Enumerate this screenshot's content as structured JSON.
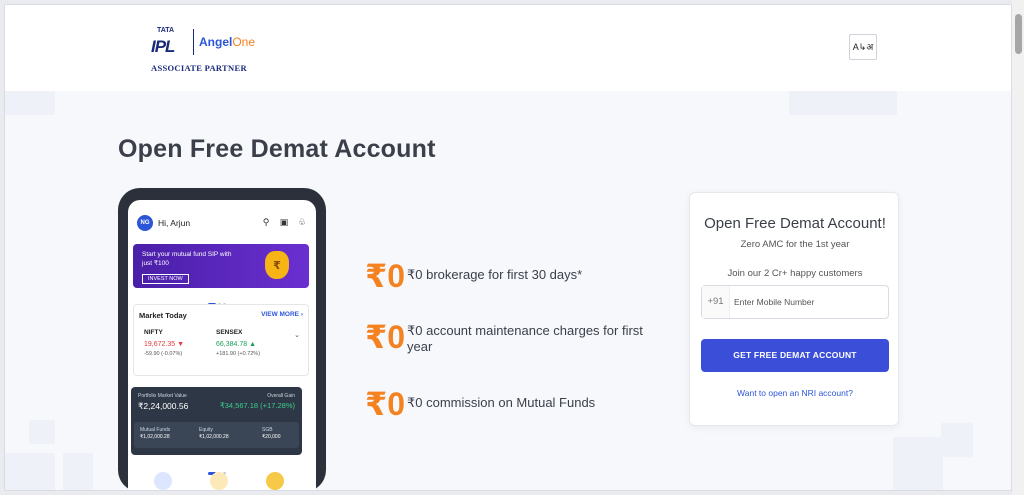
{
  "header": {
    "logo": {
      "tata": "TATA",
      "ipl": "IPL",
      "angel": "Angel",
      "one": "One",
      "partner": "ASSOCIATE PARTNER"
    },
    "language_button": "A↳अ"
  },
  "main": {
    "title": "Open Free Demat Account"
  },
  "phone": {
    "avatar": "NG",
    "greeting": "Hi, Arjun",
    "banner": {
      "text": "Start your mutual fund SIP with just ₹100",
      "button": "INVEST NOW"
    },
    "market": {
      "title": "Market Today",
      "view_more": "VIEW MORE",
      "nifty": {
        "name": "NIFTY",
        "value": "19,672.35 ▼",
        "change": "-59.90 (-0.07%)"
      },
      "sensex": {
        "name": "SENSEX",
        "value": "66,384.78 ▲",
        "change": "+181.90 (+0.72%)"
      }
    },
    "portfolio": {
      "label": "Portfolio Market Value",
      "value": "₹2,24,000.56",
      "gain_label": "Overall Gain",
      "gain": "₹34,567.18 (+17.28%)",
      "items": [
        {
          "name": "Mutual Funds",
          "value": "₹1,02,000.28"
        },
        {
          "name": "Equity",
          "value": "₹1,02,000.28"
        },
        {
          "name": "SGB",
          "value": "₹20,000"
        }
      ]
    }
  },
  "features": [
    {
      "big": "₹0",
      "text": "₹0 brokerage for first 30 days*"
    },
    {
      "big": "₹0",
      "text": "₹0 account maintenance charges for first year"
    },
    {
      "big": "₹0",
      "text": "₹0 commission on Mutual Funds"
    }
  ],
  "form": {
    "heading": "Open Free Demat Account!",
    "subheading": "Zero AMC for the 1st year",
    "join_text": "Join our 2 Cr+ happy customers",
    "country_code": "+91",
    "mobile_placeholder": "Enter Mobile Number",
    "cta": "GET FREE DEMAT ACCOUNT",
    "nri_link": "Want to open an NRI account?"
  },
  "colors": {
    "accent_orange": "#f58220",
    "cta_blue": "#3a4ed8",
    "link_blue": "#2c55d8"
  }
}
